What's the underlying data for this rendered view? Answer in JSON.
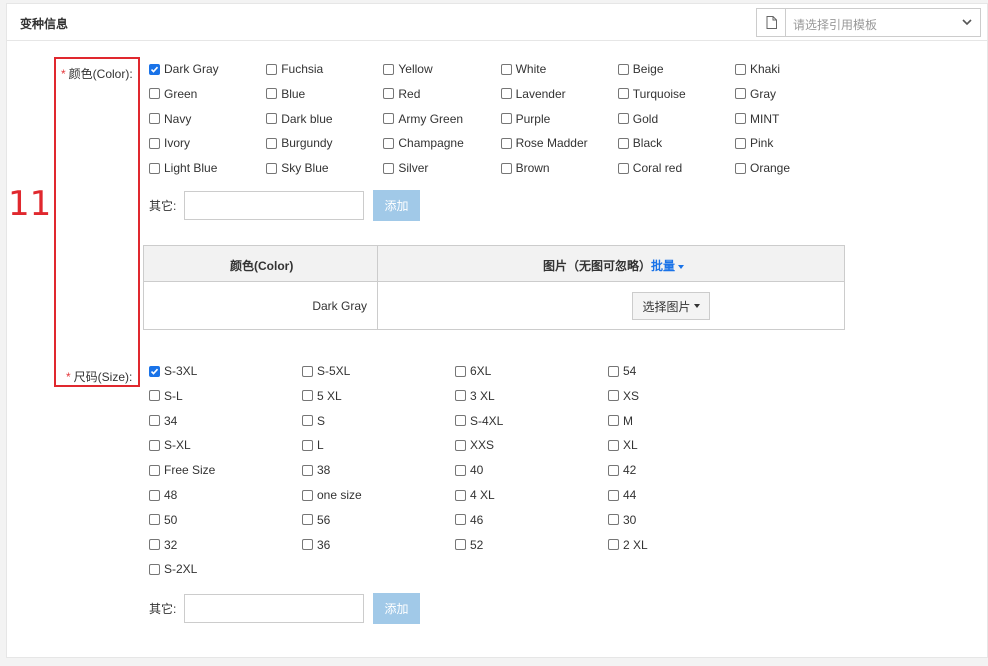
{
  "header": {
    "title": "变种信息",
    "template_placeholder": "请选择引用模板"
  },
  "color": {
    "label": "颜色(Color):",
    "options": [
      {
        "label": "Dark Gray",
        "checked": true
      },
      {
        "label": "Fuchsia",
        "checked": false
      },
      {
        "label": "Yellow",
        "checked": false
      },
      {
        "label": "White",
        "checked": false
      },
      {
        "label": "Beige",
        "checked": false
      },
      {
        "label": "Khaki",
        "checked": false
      },
      {
        "label": "Green",
        "checked": false
      },
      {
        "label": "Blue",
        "checked": false
      },
      {
        "label": "Red",
        "checked": false
      },
      {
        "label": "Lavender",
        "checked": false
      },
      {
        "label": "Turquoise",
        "checked": false
      },
      {
        "label": "Gray",
        "checked": false
      },
      {
        "label": "Navy",
        "checked": false
      },
      {
        "label": "Dark blue",
        "checked": false
      },
      {
        "label": "Army Green",
        "checked": false
      },
      {
        "label": "Purple",
        "checked": false
      },
      {
        "label": "Gold",
        "checked": false
      },
      {
        "label": "MINT",
        "checked": false
      },
      {
        "label": "Ivory",
        "checked": false
      },
      {
        "label": "Burgundy",
        "checked": false
      },
      {
        "label": "Champagne",
        "checked": false
      },
      {
        "label": "Rose Madder",
        "checked": false
      },
      {
        "label": "Black",
        "checked": false
      },
      {
        "label": "Pink",
        "checked": false
      },
      {
        "label": "Light Blue",
        "checked": false
      },
      {
        "label": "Sky Blue",
        "checked": false
      },
      {
        "label": "Silver",
        "checked": false
      },
      {
        "label": "Brown",
        "checked": false
      },
      {
        "label": "Coral red",
        "checked": false
      },
      {
        "label": "Orange",
        "checked": false
      }
    ],
    "other_label": "其它:",
    "add_label": "添加"
  },
  "color_table": {
    "col_color": "颜色(Color)",
    "col_image": "图片（无图可忽略）",
    "batch_label": "批量",
    "rows": [
      {
        "color": "Dark Gray",
        "pick_label": "选择图片"
      }
    ]
  },
  "size": {
    "label": "尺码(Size):",
    "options": [
      {
        "label": "S-3XL",
        "checked": true
      },
      {
        "label": "S-5XL",
        "checked": false
      },
      {
        "label": "6XL",
        "checked": false
      },
      {
        "label": "54",
        "checked": false
      },
      {
        "label": "S-L",
        "checked": false
      },
      {
        "label": "5 XL",
        "checked": false
      },
      {
        "label": "3 XL",
        "checked": false
      },
      {
        "label": "XS",
        "checked": false
      },
      {
        "label": "34",
        "checked": false
      },
      {
        "label": "S",
        "checked": false
      },
      {
        "label": "S-4XL",
        "checked": false
      },
      {
        "label": "M",
        "checked": false
      },
      {
        "label": "S-XL",
        "checked": false
      },
      {
        "label": "L",
        "checked": false
      },
      {
        "label": "XXS",
        "checked": false
      },
      {
        "label": "XL",
        "checked": false
      },
      {
        "label": "Free Size",
        "checked": false
      },
      {
        "label": "38",
        "checked": false
      },
      {
        "label": "40",
        "checked": false
      },
      {
        "label": "42",
        "checked": false
      },
      {
        "label": "48",
        "checked": false
      },
      {
        "label": "one size",
        "checked": false
      },
      {
        "label": "4 XL",
        "checked": false
      },
      {
        "label": "44",
        "checked": false
      },
      {
        "label": "50",
        "checked": false
      },
      {
        "label": "56",
        "checked": false
      },
      {
        "label": "46",
        "checked": false
      },
      {
        "label": "30",
        "checked": false
      },
      {
        "label": "32",
        "checked": false
      },
      {
        "label": "36",
        "checked": false
      },
      {
        "label": "52",
        "checked": false
      },
      {
        "label": "2 XL",
        "checked": false
      },
      {
        "label": "S-2XL",
        "checked": false
      }
    ],
    "other_label": "其它:",
    "add_label": "添加"
  },
  "annotation": {
    "number": "11"
  },
  "colors": {
    "accent": "#1a73e8",
    "required": "#e4393c",
    "annotation": "#e0282e",
    "add_button": "#a1c9e8"
  }
}
